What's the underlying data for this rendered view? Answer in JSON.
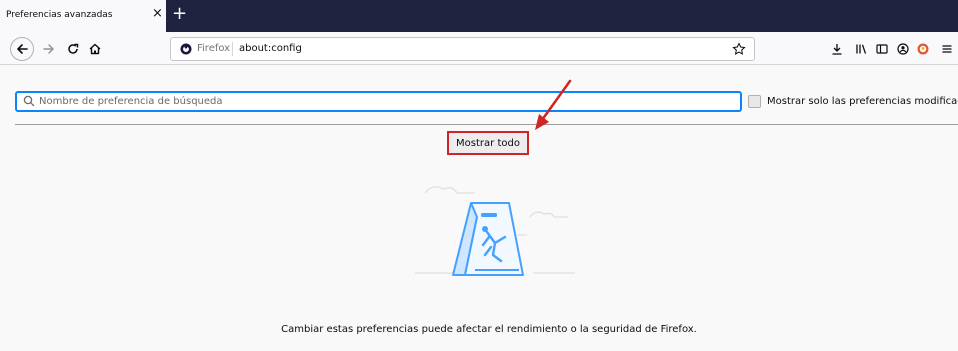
{
  "tab": {
    "title": "Preferencias avanzadas",
    "close_glyph": "×",
    "new_tab_glyph": "+"
  },
  "nav": {
    "back_icon": "back-arrow-icon",
    "forward_icon": "forward-arrow-icon",
    "reload_icon": "reload-icon",
    "home_icon": "home-icon"
  },
  "urlbar": {
    "identity_label": "Firefox",
    "url": "about:config",
    "bookmark_icon": "star-icon"
  },
  "toolbar_icons": [
    "download-icon",
    "library-icon",
    "sidebar-icon",
    "account-icon",
    "duckduckgo-icon",
    "menu-icon"
  ],
  "config": {
    "search_placeholder": "Nombre de preferencia de búsqueda",
    "checkbox_label": "Mostrar solo las preferencias modificadas",
    "checkbox_checked": false,
    "show_all_label": "Mostrar todo",
    "warning_text": "Cambiar estas preferencias puede afectar el rendimiento o la seguridad de Firefox."
  },
  "colors": {
    "tabbar": "#202340",
    "focus_ring": "#0a84ff",
    "highlight_box": "#d12424",
    "illustration": "#45a1ff"
  }
}
